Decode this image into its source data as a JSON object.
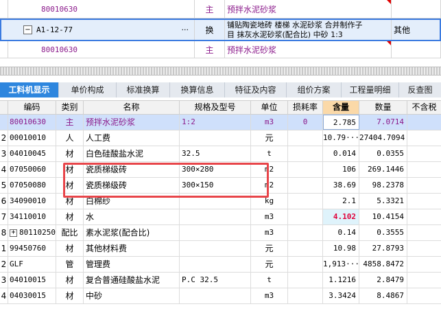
{
  "top_grid": {
    "row1": {
      "code": "80010630",
      "type": "主",
      "name": "预拌水泥砂浆"
    },
    "row2": {
      "code": "A1-12-77",
      "expander": "−",
      "ellipsis": "···",
      "type": "换",
      "name_line1": "铺贴陶瓷地砖 楼梯 水泥砂浆 合并制作子",
      "name_line2": "目 抹灰水泥砂浆(配合比) 中砂 1:3",
      "extra": "其他"
    },
    "row3": {
      "code": "80010630",
      "type": "主",
      "name": "预拌水泥砂浆"
    }
  },
  "tabs": [
    "工料机显示",
    "单价构成",
    "标准换算",
    "换算信息",
    "特征及内容",
    "组价方案",
    "工程量明细",
    "反查图"
  ],
  "headers": [
    "编码",
    "类别",
    "名称",
    "规格及型号",
    "单位",
    "损耗率",
    "含量",
    "数量",
    "不含税"
  ],
  "rows": [
    {
      "idx": "",
      "code": "80010630",
      "type": "主",
      "name": "预拌水泥砂浆",
      "spec": "1:2",
      "unit": "m3",
      "loss": "0",
      "content": "2.785",
      "qty": "7.0714"
    },
    {
      "idx": "2",
      "code": "00010010",
      "type": "人",
      "name": "人工费",
      "spec": "",
      "unit": "元",
      "loss": "",
      "content": "10.79···",
      "qty": "27404.7094"
    },
    {
      "idx": "3",
      "code": "04010045",
      "type": "材",
      "name": "白色硅酸盐水泥",
      "spec": "32.5",
      "unit": "t",
      "loss": "",
      "content": "0.014",
      "qty": "0.0355"
    },
    {
      "idx": "4",
      "code": "07050060",
      "type": "材",
      "name": "瓷质梯级砖",
      "spec": "300×280",
      "unit": "m2",
      "loss": "",
      "content": "106",
      "qty": "269.1446"
    },
    {
      "idx": "5",
      "code": "07050080",
      "type": "材",
      "name": "瓷质梯级砖",
      "spec": "300×150",
      "unit": "m2",
      "loss": "",
      "content": "38.69",
      "qty": "98.2378"
    },
    {
      "idx": "6",
      "code": "34090010",
      "type": "材",
      "name": "白棉纱",
      "spec": "",
      "unit": "kg",
      "loss": "",
      "content": "2.1",
      "qty": "5.3321"
    },
    {
      "idx": "7",
      "code": "34110010",
      "type": "材",
      "name": "水",
      "spec": "",
      "unit": "m3",
      "loss": "",
      "content": "4.102",
      "qty": "10.4154"
    },
    {
      "idx": "8",
      "code": "80110250",
      "type": "配比",
      "name": "素水泥浆(配合比)",
      "spec": "",
      "unit": "m3",
      "loss": "",
      "content": "0.14",
      "qty": "0.3555"
    },
    {
      "idx": "1",
      "code": "99450760",
      "type": "材",
      "name": "其他材料费",
      "spec": "",
      "unit": "元",
      "loss": "",
      "content": "10.98",
      "qty": "27.8793"
    },
    {
      "idx": "2",
      "code": "GLF",
      "type": "管",
      "name": "管理费",
      "spec": "",
      "unit": "元",
      "loss": "",
      "content": "1,913···",
      "qty": "4858.8472"
    },
    {
      "idx": "3",
      "code": "04010015",
      "type": "材",
      "name": "复合普通硅酸盐水泥",
      "spec": "P.C 32.5",
      "unit": "t",
      "loss": "",
      "content": "1.1216",
      "qty": "2.8479"
    },
    {
      "idx": "4",
      "code": "04030015",
      "type": "材",
      "name": "中砂",
      "spec": "",
      "unit": "m3",
      "loss": "",
      "content": "3.3424",
      "qty": "8.4867"
    }
  ],
  "expander_plus": "+",
  "colors": {
    "accent": "#2e86de",
    "highlight_header": "#fbd9a8",
    "selected_row": "#cfe0fb",
    "annotation": "#e8454a",
    "purple_text": "#8b1a8b",
    "red_value": "#e0003a"
  }
}
